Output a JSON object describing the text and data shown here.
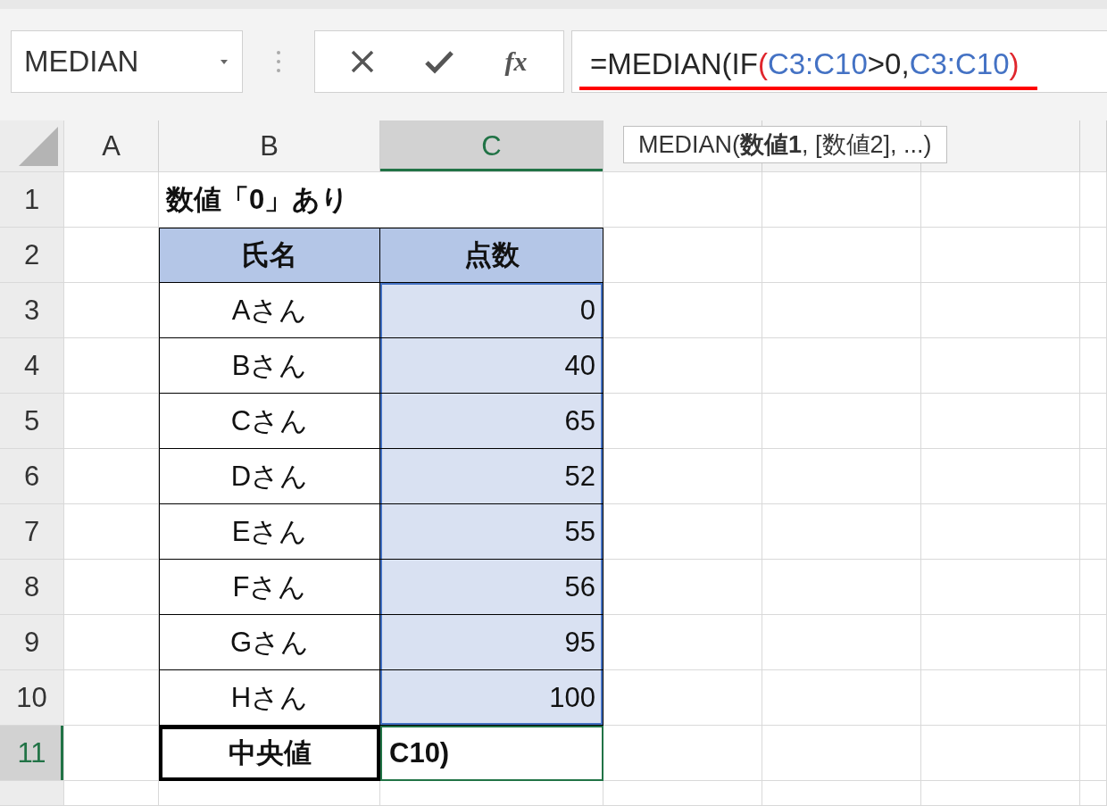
{
  "name_box": {
    "value": "MEDIAN"
  },
  "formula_buttons": [
    {
      "kind": "cancel"
    },
    {
      "kind": "enter"
    },
    {
      "kind": "function",
      "label": "fx"
    }
  ],
  "formula": {
    "segments": [
      {
        "text": "=MEDIAN(IF",
        "color": "#262626"
      },
      {
        "text": "(",
        "color": "#e0262d"
      },
      {
        "text": "C3:C10",
        "color": "#4472c4"
      },
      {
        "text": ">0,",
        "color": "#262626"
      },
      {
        "text": "C3:C10",
        "color": "#4472c4"
      },
      {
        "text": ")",
        "color": "#e0262d"
      }
    ]
  },
  "tooltip": "MEDIAN(**数値1**, [数値2], ...)",
  "columns": [
    {
      "label": "A",
      "selected": false
    },
    {
      "label": "B",
      "selected": false
    },
    {
      "label": "C",
      "selected": true
    }
  ],
  "rows": [
    {
      "number": "1",
      "selected": false,
      "kind": "title",
      "b": "数値「0」あり"
    },
    {
      "number": "2",
      "selected": false,
      "kind": "header",
      "b": "氏名",
      "c": "点数"
    },
    {
      "number": "3",
      "selected": false,
      "kind": "data",
      "highlighted": true,
      "b": "Aさん",
      "c": "0"
    },
    {
      "number": "4",
      "selected": false,
      "kind": "data",
      "highlighted": true,
      "b": "Bさん",
      "c": "40"
    },
    {
      "number": "5",
      "selected": false,
      "kind": "data",
      "highlighted": true,
      "b": "Cさん",
      "c": "65"
    },
    {
      "number": "6",
      "selected": false,
      "kind": "data",
      "highlighted": true,
      "b": "Dさん",
      "c": "52"
    },
    {
      "number": "7",
      "selected": false,
      "kind": "data",
      "highlighted": true,
      "b": "Eさん",
      "c": "55"
    },
    {
      "number": "8",
      "selected": false,
      "kind": "data",
      "highlighted": true,
      "b": "Fさん",
      "c": "56"
    },
    {
      "number": "9",
      "selected": false,
      "kind": "data",
      "highlighted": true,
      "b": "Gさん",
      "c": "95"
    },
    {
      "number": "10",
      "selected": false,
      "kind": "data",
      "highlighted": true,
      "b": "Hさん",
      "c": "100"
    },
    {
      "number": "11",
      "selected": true,
      "kind": "total",
      "b": "中央値",
      "c": "C10)"
    }
  ]
}
